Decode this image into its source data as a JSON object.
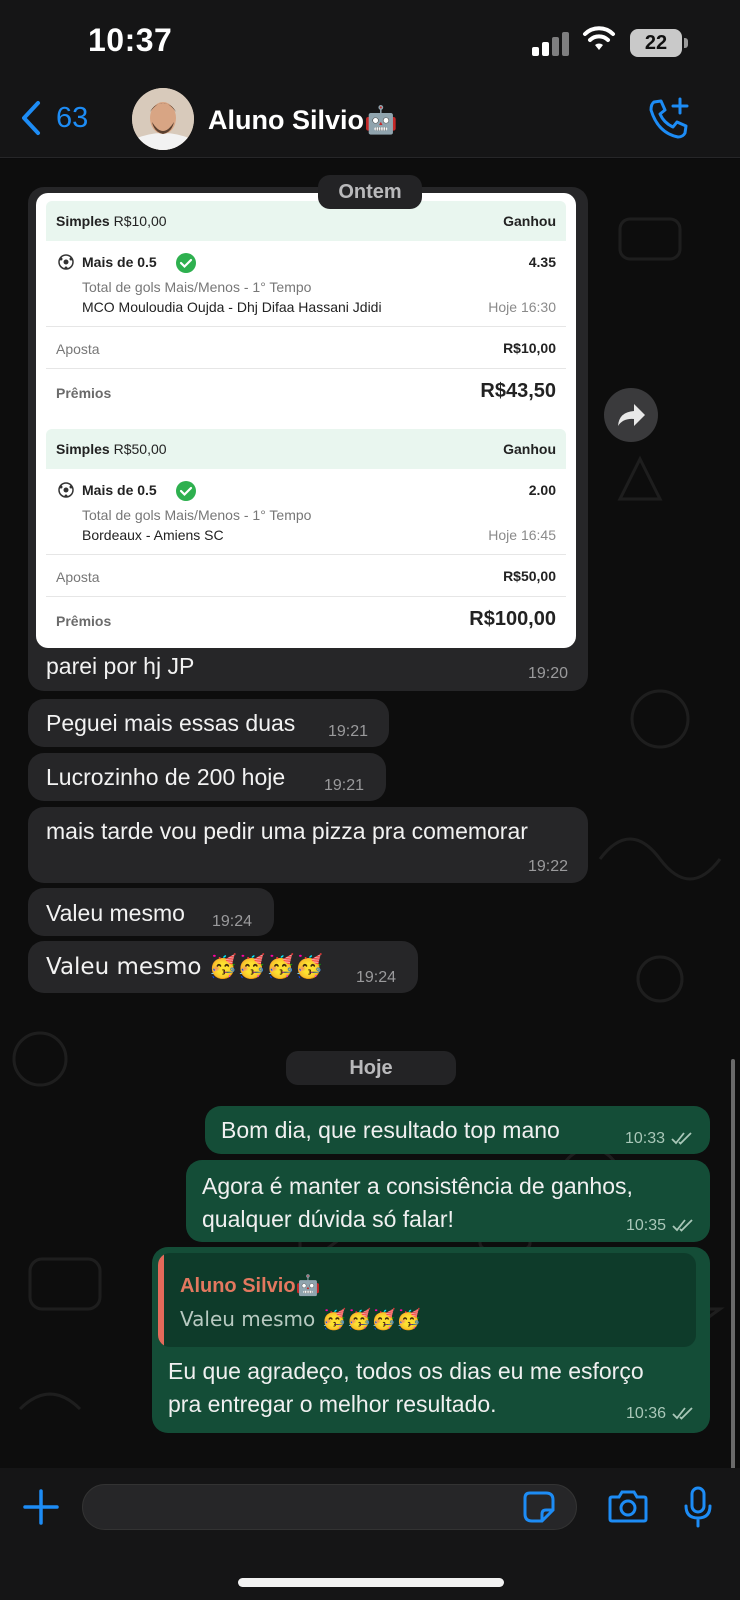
{
  "status_bar": {
    "time": "10:37",
    "battery": "22"
  },
  "header": {
    "back_count": "63",
    "contact_name": "Aluno Silvio🤖"
  },
  "dates": {
    "yesterday": "Ontem",
    "today": "Hoje"
  },
  "bet_slips": [
    {
      "type_label": "Simples",
      "stake_header": "R$10,00",
      "result": "Ganhou",
      "selection": "Mais de 0.5",
      "odd": "4.35",
      "market": "Total de gols Mais/Menos - 1° Tempo",
      "teams": "MCO Mouloudia Oujda - Dhj Difaa Hassani Jdidi",
      "when": "Hoje 16:30",
      "stake_label": "Aposta",
      "stake_value": "R$10,00",
      "prize_label": "Prêmios",
      "prize_value": "R$43,50"
    },
    {
      "type_label": "Simples",
      "stake_header": "R$50,00",
      "result": "Ganhou",
      "selection": "Mais de 0.5",
      "odd": "2.00",
      "market": "Total de gols Mais/Menos - 1° Tempo",
      "teams": "Bordeaux - Amiens SC",
      "when": "Hoje 16:45",
      "stake_label": "Aposta",
      "stake_value": "R$50,00",
      "prize_label": "Prêmios",
      "prize_value": "R$100,00"
    }
  ],
  "messages_in": [
    {
      "text": "parei por hj JP",
      "time": "19:20"
    },
    {
      "text": "Peguei mais essas duas",
      "time": "19:21"
    },
    {
      "text": "Lucrozinho de 200 hoje",
      "time": "19:21"
    },
    {
      "text": "mais tarde vou pedir uma pizza pra comemorar",
      "time": "19:22"
    },
    {
      "text": "Valeu mesmo",
      "time": "19:24"
    },
    {
      "text": "Valeu mesmo 🥳🥳🥳🥳",
      "time": "19:24"
    }
  ],
  "messages_out": [
    {
      "text": "Bom dia, que resultado top mano",
      "time": "10:33"
    },
    {
      "line1": "Agora é manter a consistência de ganhos,",
      "line2": "qualquer dúvida só falar!",
      "time": "10:35"
    },
    {
      "line1": "Eu que agradeço, todos os dias eu me esforço",
      "line2": "pra entregar o melhor resultado.",
      "time": "10:36"
    }
  ],
  "reply": {
    "name": "Aluno Silvio🤖",
    "text": "Valeu mesmo 🥳🥳🥳🥳"
  },
  "colors": {
    "accent": "#1d8cf5",
    "outgoing": "#144d37",
    "incoming": "#262628",
    "win_green": "#2eb04f"
  }
}
